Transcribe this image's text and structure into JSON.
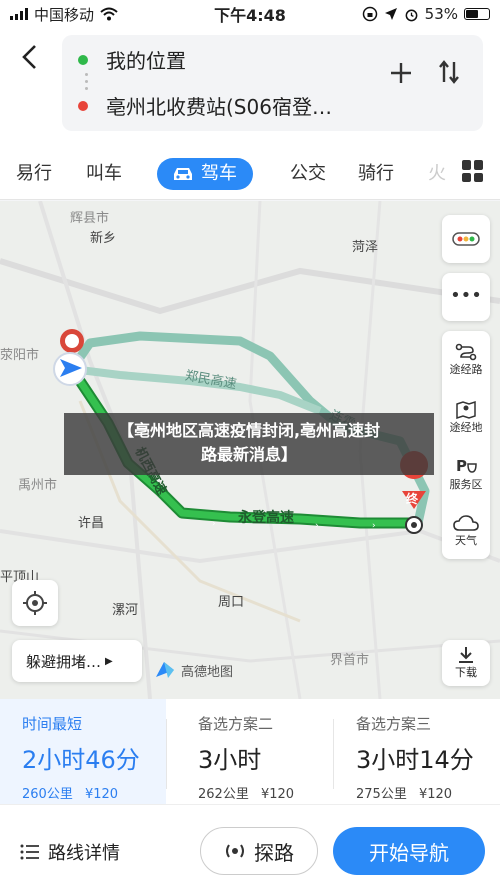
{
  "status_bar": {
    "carrier": "中国移动",
    "time": "下午4:48",
    "battery": "53%",
    "battery_level": 0.53
  },
  "header": {
    "origin": "我的位置",
    "destination": "亳州北收费站(S06宿登…"
  },
  "modes": {
    "walk": "易行",
    "taxi": "叫车",
    "drive": "驾车",
    "bus": "公交",
    "bike": "骑行",
    "more": "火"
  },
  "map": {
    "labels": {
      "huixian": "辉县市",
      "xinxiang": "新乡",
      "heze": "菏泽",
      "xingyang": "荥阳市",
      "yuzhou": "禹州市",
      "xuchang": "许昌",
      "pingdingshan": "平顶山",
      "luohe": "漯河",
      "zhoukou": "周口",
      "jieshou": "界首市",
      "zhengmin": "郑民高速",
      "lianhuo": "连霍",
      "jixi": "机西高速",
      "yongdeng": "永登高速",
      "end": "终"
    },
    "side_panel": {
      "via1": "途经路",
      "via2": "途经地",
      "service": "服务区",
      "weather": "天气"
    },
    "avoid": "躲避拥堵…",
    "logo": "高德地图",
    "download": "下载"
  },
  "overlay": {
    "line1": "【亳州地区高速疫情封闭,亳州高速封",
    "line2": "路最新消息】"
  },
  "plans": [
    {
      "title": "时间最短",
      "time": "2小时46分",
      "distance": "260公里",
      "toll": "¥120"
    },
    {
      "title": "备选方案二",
      "time": "3小时",
      "distance": "262公里",
      "toll": "¥120"
    },
    {
      "title": "备选方案三",
      "time": "3小时14分",
      "distance": "275公里",
      "toll": "¥120"
    }
  ],
  "bottom": {
    "details": "路线详情",
    "explore": "探路",
    "start": "开始导航"
  },
  "colors": {
    "accent": "#2b8af7",
    "route_main": "#2fb84a",
    "route_alt": "#8cc5b3",
    "end_marker": "#e8443a"
  }
}
